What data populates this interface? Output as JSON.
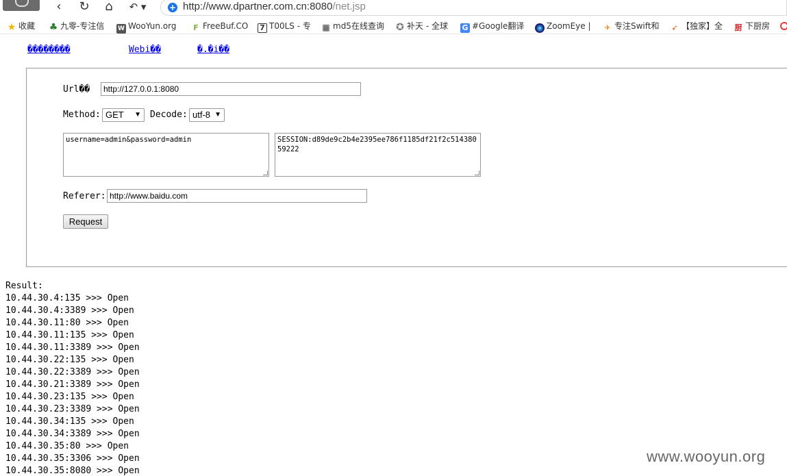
{
  "browser": {
    "url_host": "http://www.dpartner.com.cn:8080",
    "url_path": "/net.jsp",
    "nav": {
      "back": "‹",
      "reload": "↻",
      "home": "⌂",
      "undo": "↶ ▾"
    },
    "bookmarks": [
      {
        "label": "收藏",
        "icon": "star-icon",
        "color": "#f2b600"
      },
      {
        "label": "九零-专注信",
        "icon": "tree-icon",
        "color": "#2e7d32"
      },
      {
        "label": "WooYun.org",
        "icon": "wooyun-icon",
        "color": "#555555"
      },
      {
        "label": "FreeBuf.CO",
        "icon": "freebuf-icon",
        "color": "#7cb342"
      },
      {
        "label": "T00LS - 专",
        "icon": "t00ls-icon",
        "color": "#333333"
      },
      {
        "label": "md5在线查询",
        "icon": "grid-icon",
        "color": "#333333"
      },
      {
        "label": "补天 - 全球",
        "icon": "butian-icon",
        "color": "#777777"
      },
      {
        "label": "#Google翻译",
        "icon": "translate-icon",
        "color": "#4285f4"
      },
      {
        "label": "ZoomEye |",
        "icon": "zoomeye-icon",
        "color": "#1a237e"
      },
      {
        "label": "专注Swift和",
        "icon": "swift-icon",
        "color": "#f57c00"
      },
      {
        "label": "【独家】全",
        "icon": "bird-icon",
        "color": "#e65100"
      },
      {
        "label": "下厨房",
        "icon": "kitchen-icon",
        "color": "#d32f2f"
      }
    ]
  },
  "page": {
    "links": [
      "��������",
      "Webi��",
      "�.�i��"
    ],
    "url_label": "Url��",
    "url_value": "http://127.0.0.1:8080",
    "method_label": "Method:",
    "method_value": "GET",
    "decode_label": "Decode:",
    "decode_value": "utf-8",
    "post_data": "username=admin&password=admin",
    "cookie_data": "SESSION:d89de9c2b4e2395ee786f1185df21f2c51438059222",
    "referer_label": "Referer:",
    "referer_value": "http://www.baidu.com",
    "request_button": "Request"
  },
  "result": {
    "label": "Result:",
    "lines": [
      "10.44.30.4:135 >>> Open",
      "10.44.30.4:3389 >>> Open",
      "10.44.30.11:80 >>> Open",
      "10.44.30.11:135 >>> Open",
      "10.44.30.11:3389 >>> Open",
      "10.44.30.22:135 >>> Open",
      "10.44.30.22:3389 >>> Open",
      "10.44.30.21:3389 >>> Open",
      "10.44.30.23:135 >>> Open",
      "10.44.30.23:3389 >>> Open",
      "10.44.30.34:135 >>> Open",
      "10.44.30.34:3389 >>> Open",
      "10.44.30.35:80 >>> Open",
      "10.44.30.35:3306 >>> Open",
      "10.44.30.35:8080 >>> Open"
    ]
  },
  "watermark": "www.wooyun.org"
}
